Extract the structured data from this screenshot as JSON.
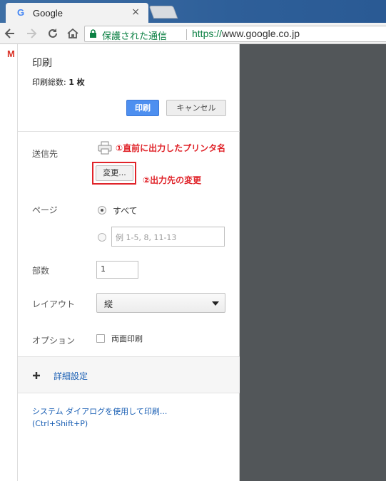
{
  "browser": {
    "tab_title": "Google",
    "tab_close": "×",
    "favicon": "G",
    "secure_label": "保護された通信",
    "url_proto": "https://",
    "url_rest": "www.google.co.jp",
    "bookmark_icon": "M"
  },
  "icons": {
    "back": "back-arrow-icon",
    "forward": "forward-arrow-icon",
    "reload": "reload-icon",
    "home": "home-icon",
    "lock": "lock-icon",
    "printer": "printer-icon",
    "plus": "plus-icon"
  },
  "panel": {
    "title": "印刷",
    "sheets_label": "印刷総数: ",
    "sheets_value": "1 枚",
    "print_button": "印刷",
    "cancel_button": "キャンセル",
    "destination_label": "送信先",
    "annotation_1": "①直前に出力したプリンタ名",
    "change_button": "変更...",
    "annotation_2": "②出力先の変更",
    "pages_label": "ページ",
    "pages_all": "すべて",
    "pages_range_placeholder": "例 1-5, 8, 11-13",
    "copies_label": "部数",
    "copies_value": "1",
    "layout_label": "レイアウト",
    "layout_value": "縦",
    "options_label": "オプション",
    "duplex_label": "両面印刷",
    "more_settings": "詳細設定",
    "system_dialog": "システム ダイアログを使用して印刷...",
    "system_dialog_shortcut": "(Ctrl+Shift+P)"
  },
  "colors": {
    "accent_blue": "#4d8ff0",
    "annotation_red": "#e0242a",
    "secure_green": "#0b8043",
    "preview_bg": "#525659"
  }
}
